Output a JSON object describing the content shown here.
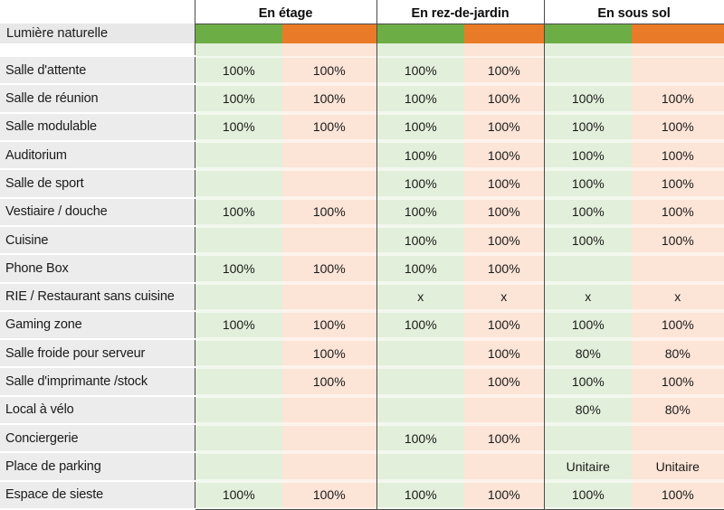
{
  "title": "Lumière naturelle",
  "header": {
    "row_label_caption": "Lumière naturelle",
    "groups": [
      {
        "label": "En étage"
      },
      {
        "label": "En rez-de-jardin"
      },
      {
        "label": "En sous sol"
      }
    ],
    "subcolumn_colors": [
      "#6dad45",
      "#e97b28"
    ],
    "subcolumn_light_colors": [
      "#e2efda",
      "#fce4d6"
    ]
  },
  "colors": {
    "green": "#6dad45",
    "orange": "#e97b28",
    "light_green": "#e2efda",
    "light_orange": "#fce4d6",
    "label_band": "#ececec",
    "grid_line": "#4a4a4a"
  },
  "rows": [
    {
      "label": "Salle d'attente",
      "values": [
        "100%",
        "100%",
        "100%",
        "100%",
        "",
        ""
      ]
    },
    {
      "label": "Salle de réunion",
      "values": [
        "100%",
        "100%",
        "100%",
        "100%",
        "100%",
        "100%"
      ]
    },
    {
      "label": "Salle modulable",
      "values": [
        "100%",
        "100%",
        "100%",
        "100%",
        "100%",
        "100%"
      ]
    },
    {
      "label": "Auditorium",
      "values": [
        "",
        "",
        "100%",
        "100%",
        "100%",
        "100%"
      ]
    },
    {
      "label": "Salle de sport",
      "values": [
        "",
        "",
        "100%",
        "100%",
        "100%",
        "100%"
      ]
    },
    {
      "label": "Vestiaire / douche",
      "values": [
        "100%",
        "100%",
        "100%",
        "100%",
        "100%",
        "100%"
      ]
    },
    {
      "label": "Cuisine",
      "values": [
        "",
        "",
        "100%",
        "100%",
        "100%",
        "100%"
      ]
    },
    {
      "label": "Phone Box",
      "values": [
        "100%",
        "100%",
        "100%",
        "100%",
        "",
        ""
      ]
    },
    {
      "label": "RIE / Restaurant sans cuisine",
      "values": [
        "",
        "",
        "x",
        "x",
        "x",
        "x"
      ]
    },
    {
      "label": "Gaming zone",
      "values": [
        "100%",
        "100%",
        "100%",
        "100%",
        "100%",
        "100%"
      ]
    },
    {
      "label": "Salle froide pour serveur",
      "values": [
        "",
        "100%",
        "",
        "100%",
        "80%",
        "80%"
      ]
    },
    {
      "label": "Salle d'imprimante /stock",
      "values": [
        "",
        "100%",
        "",
        "100%",
        "100%",
        "100%"
      ]
    },
    {
      "label": "Local à vélo",
      "values": [
        "",
        "",
        "",
        "",
        "80%",
        "80%"
      ]
    },
    {
      "label": "Conciergerie",
      "values": [
        "",
        "",
        "100%",
        "100%",
        "",
        ""
      ]
    },
    {
      "label": "Place de parking",
      "values": [
        "",
        "",
        "",
        "",
        "Unitaire",
        "Unitaire"
      ]
    },
    {
      "label": "Espace de sieste",
      "values": [
        "100%",
        "100%",
        "100%",
        "100%",
        "100%",
        "100%"
      ]
    }
  ]
}
